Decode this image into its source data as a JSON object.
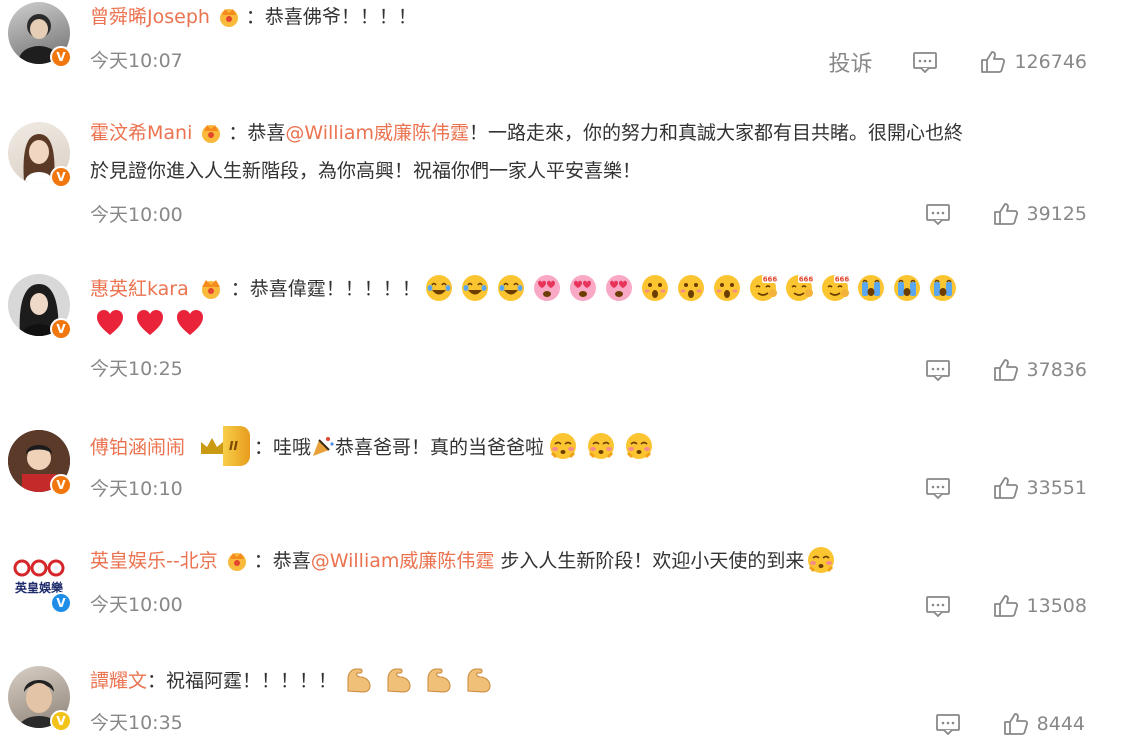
{
  "comments": [
    {
      "username": "曾舜晞Joseph",
      "parts": [
        {
          "t": "text",
          "v": "：恭喜佛爷！！！！"
        }
      ],
      "time": "今天10:07",
      "report_label": "投诉",
      "likes": "126746",
      "avatar_icon": "user-avatar",
      "badge": "orange-verified-icon"
    },
    {
      "username": "霍汶希Mani",
      "parts": [
        {
          "t": "text",
          "v": "：恭喜"
        },
        {
          "t": "mention",
          "v": "@William威廉陈伟霆"
        },
        {
          "t": "text",
          "v": "！一路走來，你的努力和真誠大家都有目共睹。很開心也終"
        },
        {
          "t": "text",
          "v": "於見證你進入人生新階段，為你高興！祝福你們一家人平安喜樂！"
        }
      ],
      "time": "今天10:00",
      "likes": "39125"
    },
    {
      "username": "惠英紅kara",
      "parts": [
        {
          "t": "text",
          "v": "：恭喜偉霆！！！！！"
        }
      ],
      "emojis_line1": [
        "laugh-cry",
        "laugh-cry",
        "laugh-cry",
        "heart-eyes",
        "heart-eyes",
        "heart-eyes",
        "surprised",
        "surprised",
        "surprised",
        "666",
        "666",
        "666",
        "cry",
        "cry",
        "cry"
      ],
      "emojis_line2": [
        "red-heart",
        "red-heart",
        "red-heart"
      ],
      "time": "今天10:25",
      "likes": "37836"
    },
    {
      "username": "傅铂涵闹闹",
      "parts": [
        {
          "t": "text",
          "v": "：哇哦"
        },
        {
          "t": "emoji",
          "v": "party-popper"
        },
        {
          "t": "text",
          "v": "恭喜爸哥！真的当爸爸啦"
        }
      ],
      "emojis_tail": [
        "kiss-blush",
        "kiss-blush",
        "kiss-blush"
      ],
      "badge_text": "II",
      "time": "今天10:10",
      "likes": "33551"
    },
    {
      "username": "英皇娱乐--北京",
      "parts": [
        {
          "t": "text",
          "v": "：恭喜"
        },
        {
          "t": "mention",
          "v": "@William威廉陈伟霆"
        },
        {
          "t": "text",
          "v": " 步入人生新阶段！欢迎小天使的到来"
        }
      ],
      "emojis_tail": [
        "kiss-blush"
      ],
      "logo_text": "英皇娛樂",
      "time": "今天10:00",
      "likes": "13508"
    },
    {
      "username": "譚耀文",
      "parts": [
        {
          "t": "text",
          "v": "：祝福阿霆！！！！！"
        }
      ],
      "emojis_tail": [
        "flex-arm",
        "flex-arm",
        "flex-arm",
        "flex-arm"
      ],
      "time": "今天10:35",
      "likes": "8444"
    }
  ],
  "colors": {
    "username": "#eb7350",
    "text": "#333333",
    "meta": "#888888",
    "verified_orange": "#f0760d",
    "verified_blue": "#1f8ee8",
    "verified_gold": "#f2c319"
  },
  "icons": {
    "comment": "comment-icon",
    "like": "thumbs-up-icon",
    "crown": "crown-icon"
  }
}
